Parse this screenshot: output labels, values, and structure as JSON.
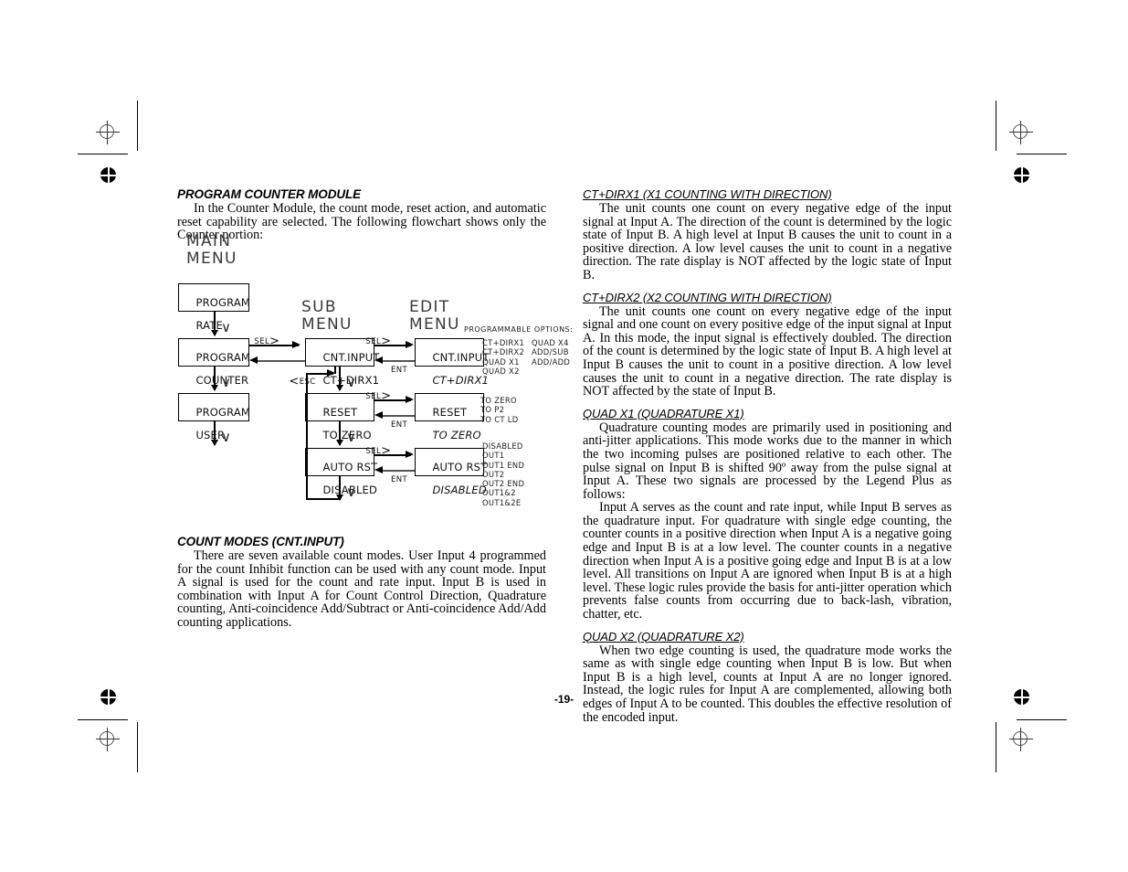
{
  "page": {
    "number": "-19-"
  },
  "left_column": {
    "section1": {
      "heading": "PROGRAM COUNTER MODULE",
      "paragraph": "In the Counter Module, the count mode, reset action, and automatic reset capability are selected. The following flowchart shows only the Counter portion:"
    },
    "section2": {
      "heading": "COUNT MODES (CNT.INPUT)",
      "paragraph": "There are seven available count modes. User Input 4 programmed for the count Inhibit function can be used with any count mode. Input A signal is used for the count and rate input. Input B is used in combination with Input A for Count Control Direction, Quadrature counting, Anti-coincidence Add/Subtract or Anti-coincidence Add/Add counting applications."
    }
  },
  "flowchart": {
    "titles": {
      "main_menu": "MAIN\nMENU",
      "sub_menu": "SUB\nMENU",
      "edit_menu": "EDIT\nMENU"
    },
    "main_menu_boxes": [
      {
        "line1": "PROGRAM",
        "line2": "RATE"
      },
      {
        "line1": "PROGRAM",
        "line2": "COUNTER"
      },
      {
        "line1": "PROGRAM",
        "line2": "USER"
      }
    ],
    "sub_menu_boxes": [
      {
        "line1": "CNT.INPUT",
        "line2": "CT+DIRX1"
      },
      {
        "line1": "RESET",
        "line2": "TO ZERO"
      },
      {
        "line1": "AUTO RST",
        "line2": "DISABLED"
      }
    ],
    "edit_menu_boxes": [
      {
        "line1": "CNT.INPUT",
        "line2": "CT+DIRX1"
      },
      {
        "line1": "RESET",
        "line2": "TO ZERO"
      },
      {
        "line1": "AUTO RST",
        "line2": "DISABLED"
      }
    ],
    "labels": {
      "sel": "SEL",
      "sel_arrow": ">",
      "esc": "ESC",
      "esc_arrow": "<",
      "ent": "ENT",
      "down_chevron": "∨"
    },
    "options_heading": "PROGRAMMABLE OPTIONS:",
    "options": {
      "cnt_input_col1": "CT+DIRX1\nCT+DIRX2\nQUAD X1\nQUAD X2",
      "cnt_input_col2": "QUAD X4\nADD/SUB\nADD/ADD",
      "reset": "TO ZERO\nTO P2\nTO CT LD",
      "auto_rst": "DISABLED\nOUT1\nOUT1 END\nOUT2\nOUT2 END\nOUT1&2\nOUT1&2E"
    }
  },
  "right_column": {
    "sections": [
      {
        "heading": "CT+DIRX1 (X1 COUNTING WITH DIRECTION)",
        "paragraph": "The unit counts one count on every negative edge of the input signal at Input A. The direction of the count is determined by the logic state of Input B. A high level at Input B causes the unit to count in a positive direction. A low level causes the unit to count in a negative direction. The rate display is NOT affected by the logic state of Input B."
      },
      {
        "heading": "CT+DIRX2 (X2 COUNTING WITH DIRECTION)",
        "paragraph": "The unit counts one count on every negative edge of the input signal and one count on every positive edge of the input signal at Input A. In this mode, the input signal is effectively doubled. The direction of the count is determined by the logic state of Input B. A high level at Input B causes the unit to count in a positive direction. A low level causes the unit to count in a negative direction. The rate display is NOT affected by the state of Input B."
      },
      {
        "heading": "QUAD X1 (QUADRATURE X1)",
        "paragraph": "Quadrature counting modes are primarily used in positioning and anti-jitter applications. This mode works due to the manner in which the two incoming pulses are positioned relative to each other. The pulse signal on Input B is shifted 90º away from the pulse signal at Input A. These two signals are processed by the Legend Plus as follows:",
        "paragraph2": "Input A serves as the count and rate input, while Input B serves as the quadrature input. For quadrature with single edge counting, the counter counts in a positive direction when Input A is a negative going edge and Input B is at a low level. The counter counts in a negative direction when Input A is a positive going edge and Input B is at a low level. All transitions on Input A are ignored when Input B is at a high level. These logic rules provide the basis for anti-jitter operation which prevents false counts from occurring due to back-lash, vibration, chatter, etc."
      },
      {
        "heading": "QUAD X2 (QUADRATURE X2)",
        "paragraph": "When two edge counting is used, the quadrature mode works the same as with single edge counting when Input B is low. But when Input B is a high level, counts at Input A are no longer ignored. Instead, the logic rules for Input A are complemented, allowing both edges of Input A to be counted. This doubles the effective resolution of the encoded input."
      }
    ]
  }
}
